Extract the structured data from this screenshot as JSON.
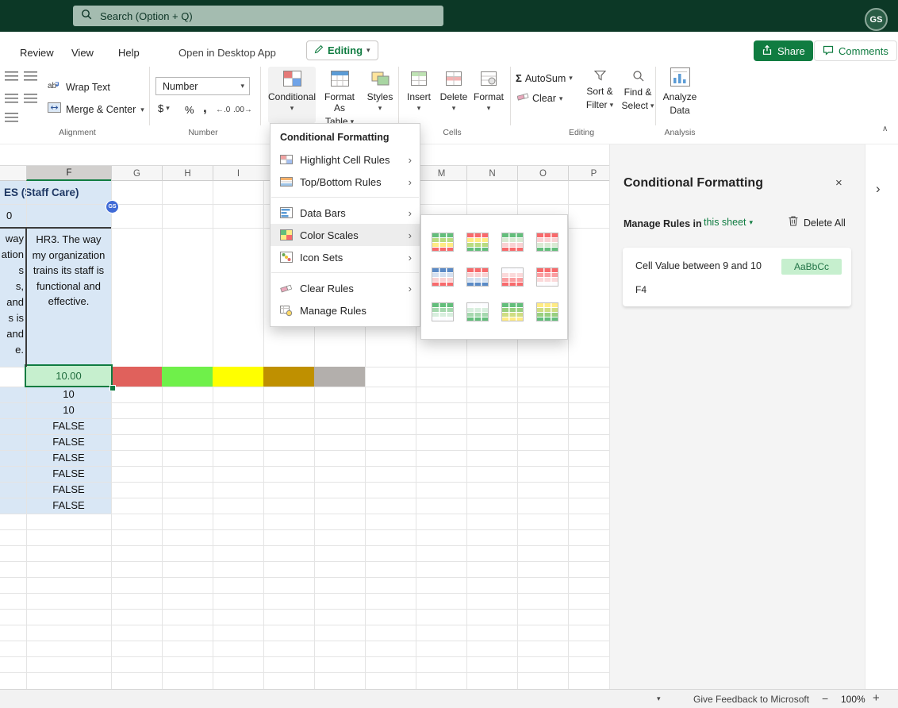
{
  "colors": {
    "brand_green": "#107c41",
    "light_blue_fill": "#d9e7f5",
    "f4_fill": "#c6efce",
    "f4_text": "#1e6b3c",
    "topbar_bg": "#0c3826"
  },
  "icons": {
    "chevron_down": "▾",
    "chevron_right": "›",
    "close": "×",
    "collapse_ribbon": "∧",
    "expand_pane": "›",
    "minus": "−",
    "plus": "+"
  },
  "topbar": {
    "search_placeholder": "Search (Option + Q)",
    "avatar_initials": "GS"
  },
  "ribbon": {
    "tabs": [
      "Review",
      "View",
      "Help"
    ],
    "open_in_desktop": "Open in Desktop App",
    "editing_mode": "Editing",
    "share": "Share",
    "comments": "Comments",
    "alignment": {
      "wrap_text": "Wrap Text",
      "merge_center": "Merge & Center",
      "label": "Alignment"
    },
    "number": {
      "format": "Number",
      "dollar": "$",
      "percent": "%",
      "comma": ",",
      "increase_decimal": "←.0",
      "decrease_decimal": ".00→",
      "label": "Number"
    },
    "styles": {
      "conditional": "Conditional",
      "format_as": "Format As",
      "table": "Table",
      "styles": "Styles"
    },
    "cells": {
      "insert": "Insert",
      "delete": "Delete",
      "format": "Format",
      "label": "Cells"
    },
    "editing": {
      "sigma": "Σ",
      "autosum": "AutoSum",
      "clear": "Clear",
      "sort_line1": "Sort &",
      "sort_line2": "Filter",
      "find_line1": "Find &",
      "find_line2": "Select",
      "label": "Editing"
    },
    "analysis": {
      "line1": "Analyze",
      "line2": "Data",
      "label": "Analysis"
    }
  },
  "menu": {
    "title": "Conditional Formatting",
    "items": [
      {
        "label": "Highlight Cell Rules",
        "icon": "highlight-cell-rules-icon",
        "submenu": true,
        "highlighted": false
      },
      {
        "label": "Top/Bottom Rules",
        "icon": "top-bottom-rules-icon",
        "submenu": true,
        "highlighted": false
      },
      {
        "label": "Data Bars",
        "icon": "data-bars-icon",
        "submenu": true,
        "highlighted": false
      },
      {
        "label": "Color Scales",
        "icon": "color-scales-icon",
        "submenu": true,
        "highlighted": true
      },
      {
        "label": "Icon Sets",
        "icon": "icon-sets-icon",
        "submenu": true,
        "highlighted": false
      },
      {
        "label": "Clear Rules",
        "icon": "clear-rules-icon",
        "submenu": true,
        "highlighted": false
      },
      {
        "label": "Manage Rules",
        "icon": "manage-rules-icon",
        "submenu": false,
        "highlighted": false
      }
    ]
  },
  "gallery": {
    "options": [
      {
        "name": "Green - Yellow - Red",
        "stripes": [
          "#63be7b",
          "#b9dc81",
          "#ffeb84",
          "#f8696b"
        ]
      },
      {
        "name": "Red - Yellow - Green",
        "stripes": [
          "#f8696b",
          "#ffeb84",
          "#b9dc81",
          "#63be7b"
        ]
      },
      {
        "name": "Green - White - Red",
        "stripes": [
          "#63be7b",
          "#d9ead3",
          "#f9d2d3",
          "#f8696b"
        ]
      },
      {
        "name": "Red - White - Green",
        "stripes": [
          "#f8696b",
          "#f9d2d3",
          "#d9ead3",
          "#63be7b"
        ]
      },
      {
        "name": "Blue - White - Red",
        "stripes": [
          "#5a8ac6",
          "#d4e0f0",
          "#f9d2d3",
          "#f8696b"
        ]
      },
      {
        "name": "Red - White - Blue",
        "stripes": [
          "#f8696b",
          "#f9d2d3",
          "#d4e0f0",
          "#5a8ac6"
        ]
      },
      {
        "name": "White - Red",
        "stripes": [
          "#fcfcff",
          "#fbd9da",
          "#fa9da0",
          "#f8696b"
        ]
      },
      {
        "name": "Red - White",
        "stripes": [
          "#f8696b",
          "#fa9da0",
          "#fbd9da",
          "#fcfcff"
        ]
      },
      {
        "name": "Green - White",
        "stripes": [
          "#63be7b",
          "#a5d8ae",
          "#d8eede",
          "#fcfcff"
        ]
      },
      {
        "name": "White - Green",
        "stripes": [
          "#fcfcff",
          "#d8eede",
          "#a5d8ae",
          "#63be7b"
        ]
      },
      {
        "name": "Green - Yellow",
        "stripes": [
          "#63be7b",
          "#98cf7f",
          "#cfdd82",
          "#ffeb84"
        ]
      },
      {
        "name": "Yellow - Green",
        "stripes": [
          "#ffeb84",
          "#cfdd82",
          "#98cf7f",
          "#63be7b"
        ]
      }
    ]
  },
  "sheet": {
    "columns": [
      "F",
      "G",
      "H",
      "I",
      "M",
      "N",
      "O",
      "P"
    ],
    "merged_header": "ES (Staff Care)",
    "row2_value": "0",
    "e3_fragments": [
      "way",
      "ation",
      "s",
      "s,",
      "and",
      "s is",
      "and",
      "e."
    ],
    "f3_text": "HR3. The way my organization trains its staff is functional and effective.",
    "f4_value": "10.00",
    "f_values": [
      "10",
      "10",
      "FALSE",
      "FALSE",
      "FALSE",
      "FALSE",
      "FALSE",
      "FALSE"
    ],
    "row4_colors": [
      "#e0615c",
      "#6ff04a",
      "#ffff00",
      "#bf9000",
      "#b3afac"
    ],
    "presence_initials": "GS"
  },
  "pane": {
    "title": "Conditional Formatting",
    "manage_label": "Manage Rules in",
    "scope": "this sheet",
    "delete_all": "Delete All",
    "rule_text": "Cell Value between 9 and 10",
    "rule_preview": "AaBbCc",
    "rule_range": "F4"
  },
  "statusbar": {
    "feedback": "Give Feedback to Microsoft",
    "zoom": "100%"
  }
}
